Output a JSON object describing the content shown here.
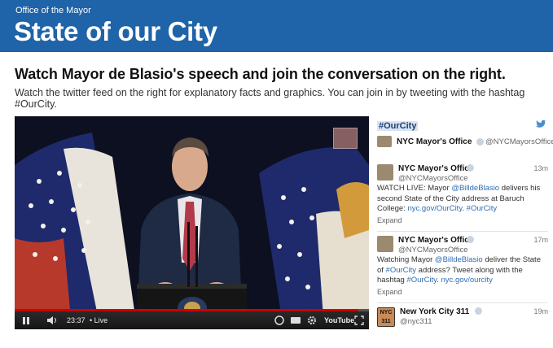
{
  "banner": {
    "supertitle": "Office of the Mayor",
    "title": "State of our City"
  },
  "intro": {
    "headline": "Watch Mayor de Blasio's speech and join the conversation on the right.",
    "subline": "Watch the twitter feed on the right for explanatory facts and graphics. You can join in by tweeting with the hashtag #OurCity."
  },
  "video": {
    "time": "23:37",
    "live_label": "• Live",
    "youtube_label": "YouTube",
    "progress_fraction": 0.97,
    "icons": [
      "play-pause-icon",
      "volume-icon",
      "captions-icon",
      "settings-icon",
      "fullscreen-icon"
    ]
  },
  "feed": {
    "hashtag": "#OurCity",
    "owner_name": "NYC Mayor's Office",
    "owner_handle": "@NYCMayorsOffice",
    "tweets": [
      {
        "name": "NYC Mayor's Office",
        "handle": "@NYCMayorsOffice",
        "time": "13m",
        "text_1": "WATCH LIVE: Mayor ",
        "mention": "@BilldeBlasio",
        "text_2": " delivers his second State of the City address at Baruch College: ",
        "link": "nyc.gov/OurCity",
        "text_3": ". ",
        "tag": "#OurCity",
        "expand": "Expand"
      },
      {
        "name": "NYC Mayor's Office",
        "handle": "@NYCMayorsOffice",
        "time": "17m",
        "text_1": "Watching Mayor ",
        "mention": "@BilldeBlasio",
        "text_2": " deliver the State of ",
        "tag": "#OurCity",
        "text_3": " address? Tweet along with the hashtag ",
        "tag2": "#OurCity",
        "text_4": ". ",
        "link": "nyc.gov/ourcity",
        "expand": "Expand"
      },
      {
        "name": "New York City 311",
        "handle": "@nyc311",
        "time": "19m",
        "avatar_text_1": "NYC",
        "avatar_text_2": "311"
      }
    ]
  },
  "colors": {
    "banner": "#1f63a8",
    "link": "#2f6db3",
    "hashtag_bg": "#d9e4f2"
  }
}
